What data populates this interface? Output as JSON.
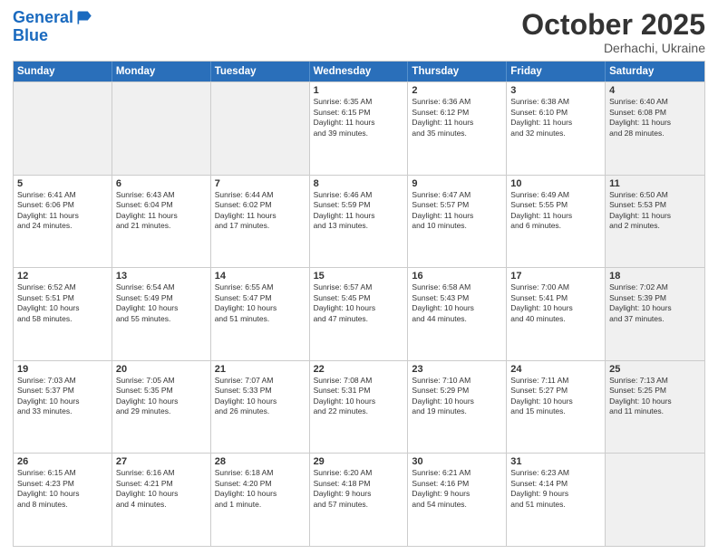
{
  "header": {
    "logo_line1": "General",
    "logo_line2": "Blue",
    "month": "October 2025",
    "location": "Derhachi, Ukraine"
  },
  "weekdays": [
    "Sunday",
    "Monday",
    "Tuesday",
    "Wednesday",
    "Thursday",
    "Friday",
    "Saturday"
  ],
  "rows": [
    [
      {
        "day": "",
        "text": "",
        "shaded": true
      },
      {
        "day": "",
        "text": "",
        "shaded": true
      },
      {
        "day": "",
        "text": "",
        "shaded": true
      },
      {
        "day": "1",
        "text": "Sunrise: 6:35 AM\nSunset: 6:15 PM\nDaylight: 11 hours\nand 39 minutes.",
        "shaded": false
      },
      {
        "day": "2",
        "text": "Sunrise: 6:36 AM\nSunset: 6:12 PM\nDaylight: 11 hours\nand 35 minutes.",
        "shaded": false
      },
      {
        "day": "3",
        "text": "Sunrise: 6:38 AM\nSunset: 6:10 PM\nDaylight: 11 hours\nand 32 minutes.",
        "shaded": false
      },
      {
        "day": "4",
        "text": "Sunrise: 6:40 AM\nSunset: 6:08 PM\nDaylight: 11 hours\nand 28 minutes.",
        "shaded": true
      }
    ],
    [
      {
        "day": "5",
        "text": "Sunrise: 6:41 AM\nSunset: 6:06 PM\nDaylight: 11 hours\nand 24 minutes.",
        "shaded": false
      },
      {
        "day": "6",
        "text": "Sunrise: 6:43 AM\nSunset: 6:04 PM\nDaylight: 11 hours\nand 21 minutes.",
        "shaded": false
      },
      {
        "day": "7",
        "text": "Sunrise: 6:44 AM\nSunset: 6:02 PM\nDaylight: 11 hours\nand 17 minutes.",
        "shaded": false
      },
      {
        "day": "8",
        "text": "Sunrise: 6:46 AM\nSunset: 5:59 PM\nDaylight: 11 hours\nand 13 minutes.",
        "shaded": false
      },
      {
        "day": "9",
        "text": "Sunrise: 6:47 AM\nSunset: 5:57 PM\nDaylight: 11 hours\nand 10 minutes.",
        "shaded": false
      },
      {
        "day": "10",
        "text": "Sunrise: 6:49 AM\nSunset: 5:55 PM\nDaylight: 11 hours\nand 6 minutes.",
        "shaded": false
      },
      {
        "day": "11",
        "text": "Sunrise: 6:50 AM\nSunset: 5:53 PM\nDaylight: 11 hours\nand 2 minutes.",
        "shaded": true
      }
    ],
    [
      {
        "day": "12",
        "text": "Sunrise: 6:52 AM\nSunset: 5:51 PM\nDaylight: 10 hours\nand 58 minutes.",
        "shaded": false
      },
      {
        "day": "13",
        "text": "Sunrise: 6:54 AM\nSunset: 5:49 PM\nDaylight: 10 hours\nand 55 minutes.",
        "shaded": false
      },
      {
        "day": "14",
        "text": "Sunrise: 6:55 AM\nSunset: 5:47 PM\nDaylight: 10 hours\nand 51 minutes.",
        "shaded": false
      },
      {
        "day": "15",
        "text": "Sunrise: 6:57 AM\nSunset: 5:45 PM\nDaylight: 10 hours\nand 47 minutes.",
        "shaded": false
      },
      {
        "day": "16",
        "text": "Sunrise: 6:58 AM\nSunset: 5:43 PM\nDaylight: 10 hours\nand 44 minutes.",
        "shaded": false
      },
      {
        "day": "17",
        "text": "Sunrise: 7:00 AM\nSunset: 5:41 PM\nDaylight: 10 hours\nand 40 minutes.",
        "shaded": false
      },
      {
        "day": "18",
        "text": "Sunrise: 7:02 AM\nSunset: 5:39 PM\nDaylight: 10 hours\nand 37 minutes.",
        "shaded": true
      }
    ],
    [
      {
        "day": "19",
        "text": "Sunrise: 7:03 AM\nSunset: 5:37 PM\nDaylight: 10 hours\nand 33 minutes.",
        "shaded": false
      },
      {
        "day": "20",
        "text": "Sunrise: 7:05 AM\nSunset: 5:35 PM\nDaylight: 10 hours\nand 29 minutes.",
        "shaded": false
      },
      {
        "day": "21",
        "text": "Sunrise: 7:07 AM\nSunset: 5:33 PM\nDaylight: 10 hours\nand 26 minutes.",
        "shaded": false
      },
      {
        "day": "22",
        "text": "Sunrise: 7:08 AM\nSunset: 5:31 PM\nDaylight: 10 hours\nand 22 minutes.",
        "shaded": false
      },
      {
        "day": "23",
        "text": "Sunrise: 7:10 AM\nSunset: 5:29 PM\nDaylight: 10 hours\nand 19 minutes.",
        "shaded": false
      },
      {
        "day": "24",
        "text": "Sunrise: 7:11 AM\nSunset: 5:27 PM\nDaylight: 10 hours\nand 15 minutes.",
        "shaded": false
      },
      {
        "day": "25",
        "text": "Sunrise: 7:13 AM\nSunset: 5:25 PM\nDaylight: 10 hours\nand 11 minutes.",
        "shaded": true
      }
    ],
    [
      {
        "day": "26",
        "text": "Sunrise: 6:15 AM\nSunset: 4:23 PM\nDaylight: 10 hours\nand 8 minutes.",
        "shaded": false
      },
      {
        "day": "27",
        "text": "Sunrise: 6:16 AM\nSunset: 4:21 PM\nDaylight: 10 hours\nand 4 minutes.",
        "shaded": false
      },
      {
        "day": "28",
        "text": "Sunrise: 6:18 AM\nSunset: 4:20 PM\nDaylight: 10 hours\nand 1 minute.",
        "shaded": false
      },
      {
        "day": "29",
        "text": "Sunrise: 6:20 AM\nSunset: 4:18 PM\nDaylight: 9 hours\nand 57 minutes.",
        "shaded": false
      },
      {
        "day": "30",
        "text": "Sunrise: 6:21 AM\nSunset: 4:16 PM\nDaylight: 9 hours\nand 54 minutes.",
        "shaded": false
      },
      {
        "day": "31",
        "text": "Sunrise: 6:23 AM\nSunset: 4:14 PM\nDaylight: 9 hours\nand 51 minutes.",
        "shaded": false
      },
      {
        "day": "",
        "text": "",
        "shaded": true
      }
    ]
  ]
}
